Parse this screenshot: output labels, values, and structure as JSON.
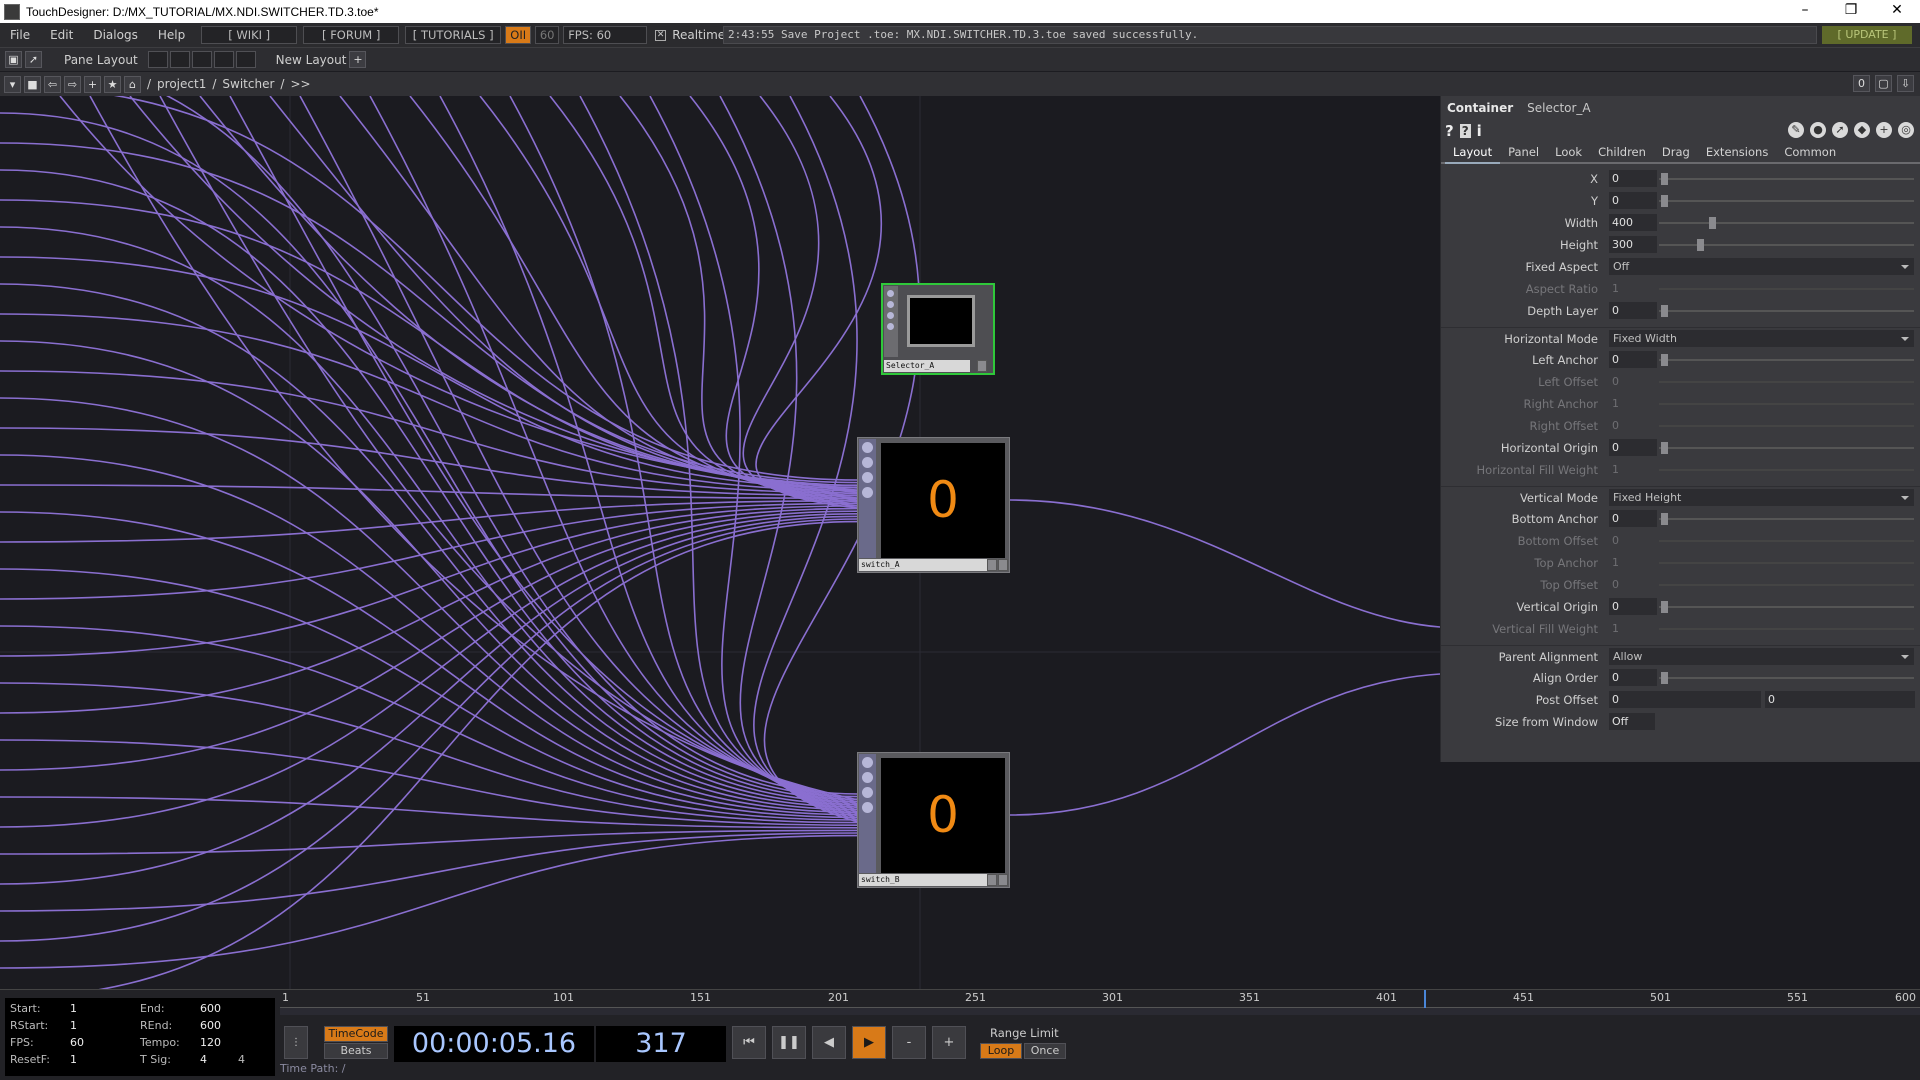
{
  "window": {
    "title": "TouchDesigner: D:/MX_TUTORIAL/MX.NDI.SWITCHER.TD.3.toe*"
  },
  "menu": [
    "File",
    "Edit",
    "Dialogs",
    "Help"
  ],
  "toolbar": {
    "wiki": "[ WIKI ]",
    "forum": "[ FORUM ]",
    "tutorials": "[ TUTORIALS ]",
    "perf": "OII",
    "fps_cap": "60",
    "fps": "FPS:  60",
    "realtime": "Realtime",
    "status": "2:43:55 Save Project .toe: MX.NDI.SWITCHER.TD.3.toe saved successfully.",
    "update": "[ UPDATE ]"
  },
  "panebar": {
    "pane_layout": "Pane Layout",
    "new_layout": "New Layout"
  },
  "pathbar": {
    "root": "/",
    "project": "project1",
    "sep": "/",
    "switcher": "Switcher",
    "more": ">>",
    "right_value": "0"
  },
  "nodes": {
    "selector": {
      "label": "Selector_A"
    },
    "switch_a": {
      "label": "switch_A",
      "value": "0"
    },
    "switch_b": {
      "label": "switch_B",
      "value": "0"
    }
  },
  "params": {
    "type": "Container",
    "name": "Selector_A",
    "tabs": [
      "Layout",
      "Panel",
      "Look",
      "Children",
      "Drag",
      "Extensions",
      "Common"
    ],
    "rows": [
      {
        "label": "X",
        "value": "0"
      },
      {
        "label": "Y",
        "value": "0"
      },
      {
        "label": "Width",
        "value": "400"
      },
      {
        "label": "Height",
        "value": "300"
      },
      {
        "label": "Fixed Aspect",
        "value": "Off"
      },
      {
        "label": "Aspect Ratio",
        "value": "1"
      },
      {
        "label": "Depth Layer",
        "value": "0"
      },
      {
        "label": "Horizontal Mode",
        "value": "Fixed Width"
      },
      {
        "label": "Left Anchor",
        "value": "0"
      },
      {
        "label": "Left Offset",
        "value": "0"
      },
      {
        "label": "Right Anchor",
        "value": "1"
      },
      {
        "label": "Right Offset",
        "value": "0"
      },
      {
        "label": "Horizontal Origin",
        "value": "0"
      },
      {
        "label": "Horizontal Fill Weight",
        "value": "1"
      },
      {
        "label": "Vertical Mode",
        "value": "Fixed Height"
      },
      {
        "label": "Bottom Anchor",
        "value": "0"
      },
      {
        "label": "Bottom Offset",
        "value": "0"
      },
      {
        "label": "Top Anchor",
        "value": "1"
      },
      {
        "label": "Top Offset",
        "value": "0"
      },
      {
        "label": "Vertical Origin",
        "value": "0"
      },
      {
        "label": "Vertical Fill Weight",
        "value": "1"
      },
      {
        "label": "Parent Alignment",
        "value": "Allow"
      },
      {
        "label": "Align Order",
        "value": "0"
      },
      {
        "label": "Post Offset",
        "value": "0",
        "value2": "0"
      },
      {
        "label": "Size from Window",
        "value": "Off"
      }
    ]
  },
  "timeline": {
    "info": [
      {
        "k": "Start:",
        "v": "1"
      },
      {
        "k": "End:",
        "v": "600"
      },
      {
        "k": "RStart:",
        "v": "1"
      },
      {
        "k": "REnd:",
        "v": "600"
      },
      {
        "k": "FPS:",
        "v": "60"
      },
      {
        "k": "Tempo:",
        "v": "120"
      },
      {
        "k": "ResetF:",
        "v": "1"
      },
      {
        "k": "T Sig:",
        "v": "4"
      },
      {
        "k": "",
        "v": "4"
      }
    ],
    "ticks": [
      "1",
      "51",
      "101",
      "151",
      "201",
      "251",
      "301",
      "351",
      "401",
      "451",
      "501",
      "551",
      "600"
    ],
    "timecode_label": "TimeCode",
    "beats_label": "Beats",
    "timecode": "00:00:05.16",
    "frame": "317",
    "minus": "-",
    "plus": "+",
    "range_limit": "Range Limit",
    "loop": "Loop",
    "once": "Once",
    "time_path": "Time Path: /"
  }
}
